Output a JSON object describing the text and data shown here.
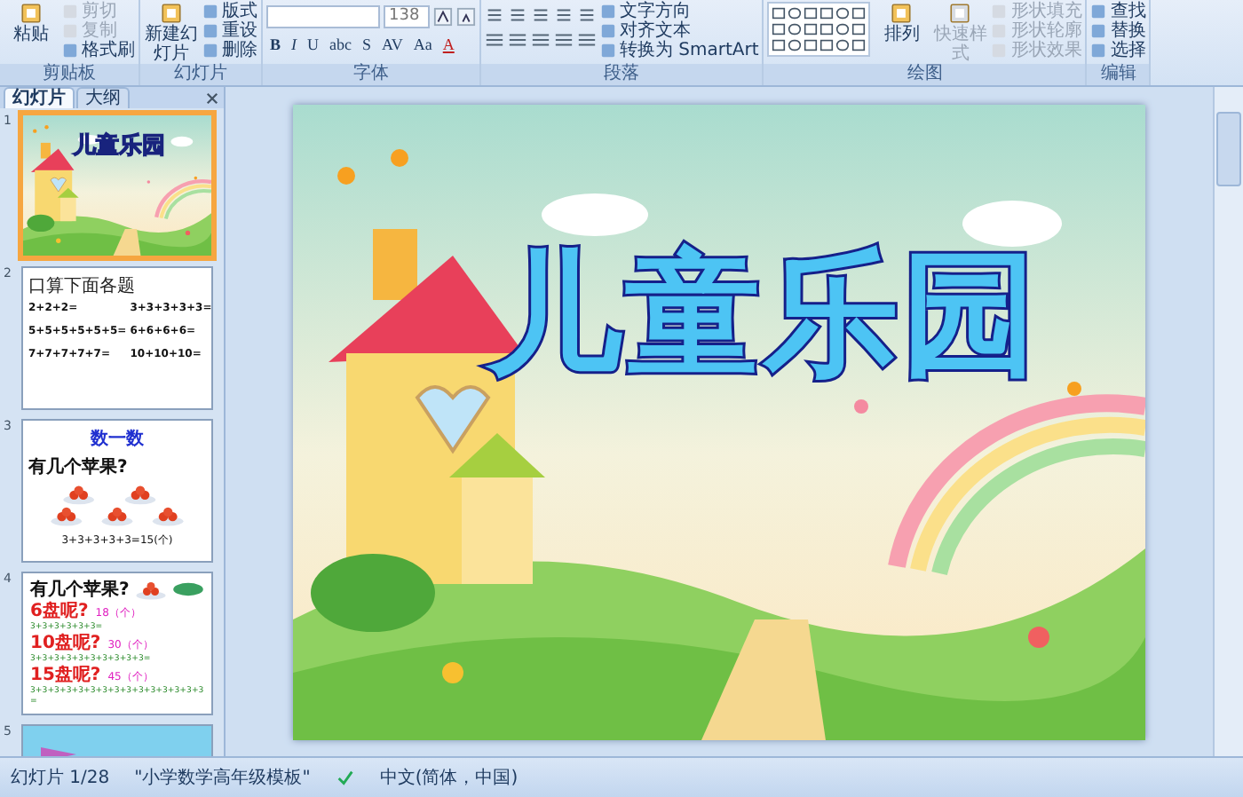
{
  "ribbon": {
    "groups": [
      {
        "kind": "clipboard",
        "label": "剪贴板",
        "big": [
          {
            "label": "粘贴",
            "disabled": false
          }
        ],
        "small": [
          {
            "label": "剪切",
            "disabled": true
          },
          {
            "label": "复制",
            "disabled": true
          },
          {
            "label": "格式刷",
            "disabled": false
          }
        ]
      },
      {
        "kind": "slides",
        "label": "幻灯片",
        "big": [
          {
            "label": "新建幻灯片",
            "disabled": false
          }
        ],
        "small": [
          {
            "label": "版式",
            "disabled": false
          },
          {
            "label": "重设",
            "disabled": false
          },
          {
            "label": "删除",
            "disabled": false
          }
        ]
      },
      {
        "kind": "font",
        "label": "字体",
        "font_size": "138",
        "format_buttons": [
          "B",
          "I",
          "U",
          "abc",
          "S",
          "AV",
          "Aa",
          "A"
        ]
      },
      {
        "kind": "paragraph",
        "label": "段落",
        "small": [
          {
            "label": "文字方向",
            "disabled": false
          },
          {
            "label": "对齐文本",
            "disabled": false
          },
          {
            "label": "转换为 SmartArt",
            "disabled": false
          }
        ]
      },
      {
        "kind": "drawing",
        "label": "绘图",
        "big": [
          {
            "label": "排列",
            "disabled": false
          },
          {
            "label": "快速样式",
            "disabled": true
          }
        ],
        "small": [
          {
            "label": "形状填充",
            "disabled": true
          },
          {
            "label": "形状轮廓",
            "disabled": true
          },
          {
            "label": "形状效果",
            "disabled": true
          }
        ]
      },
      {
        "kind": "editing",
        "label": "编辑",
        "small": [
          {
            "label": "查找",
            "disabled": false
          },
          {
            "label": "替换",
            "disabled": false
          },
          {
            "label": "选择",
            "disabled": false
          }
        ]
      }
    ]
  },
  "panel": {
    "tabs": [
      {
        "label": "幻灯片",
        "selected": true
      },
      {
        "label": "大纲",
        "selected": false
      }
    ],
    "slides": [
      {
        "number": "1",
        "selected": true,
        "kind": "cover",
        "title": "儿童乐园"
      },
      {
        "number": "2",
        "selected": false,
        "kind": "exercises",
        "heading": "口算下面各题",
        "lines": [
          "2+2+2=",
          "3+3+3+3+3=",
          "5+5+5+5+5+5=",
          "6+6+6+6=",
          "7+7+7+7+7=",
          "10+10+10="
        ]
      },
      {
        "number": "3",
        "selected": false,
        "kind": "count",
        "heading": "数一数",
        "question": "有几个苹果?",
        "answer": "3+3+3+3+3=15(个)"
      },
      {
        "number": "4",
        "selected": false,
        "kind": "plates",
        "question": "有几个苹果?",
        "lines": [
          {
            "label": "6盘呢?",
            "expr": "3+3+3+3+3+3=",
            "result": "18（个）"
          },
          {
            "label": "10盘呢?",
            "expr": "3+3+3+3+3+3+3+3+3+3=",
            "result": "30（个）"
          },
          {
            "label": "15盘呢?",
            "expr": "3+3+3+3+3+3+3+3+3+3+3+3+3+3+3=",
            "result": "45（个）"
          }
        ]
      },
      {
        "number": "5",
        "selected": false,
        "kind": "picture"
      }
    ]
  },
  "slide": {
    "title": "儿童乐园"
  },
  "status_bar": {
    "slide": "幻灯片 1/28",
    "theme": "\"小学数学高年级模板\"",
    "language": "中文(简体，中国)"
  }
}
